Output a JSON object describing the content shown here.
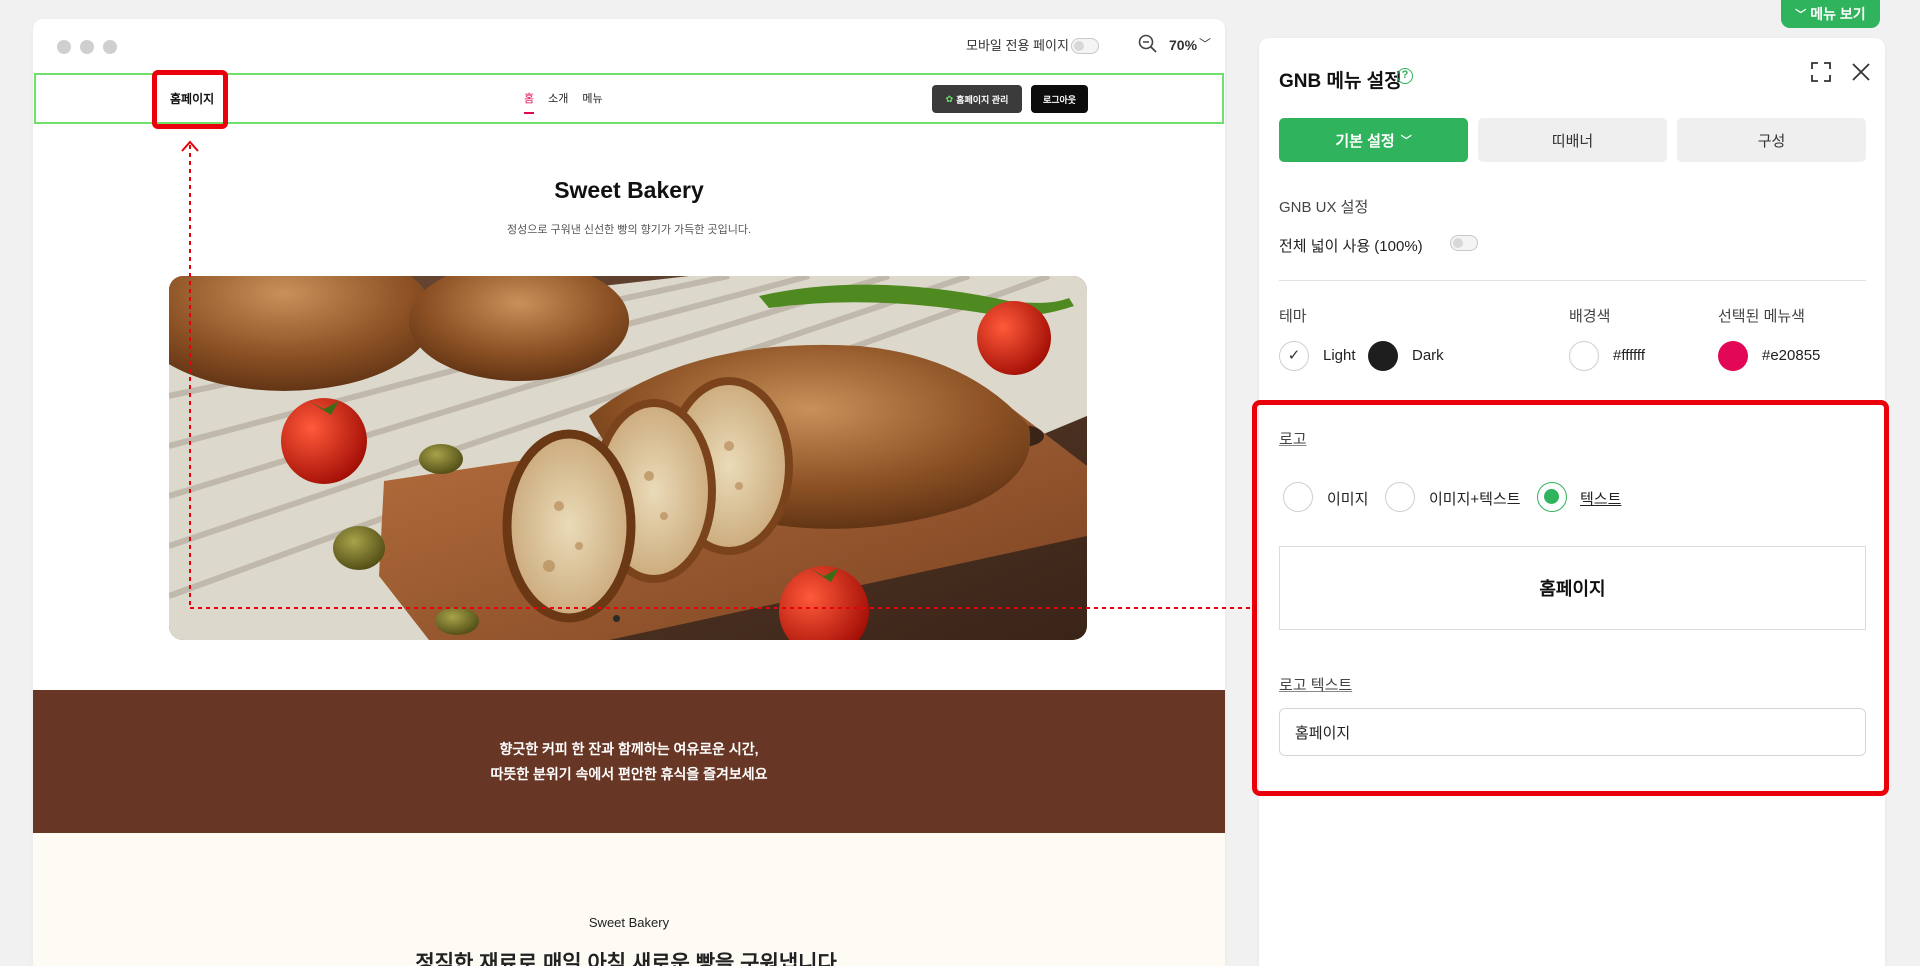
{
  "top_tab": {
    "label": "메뉴 보기"
  },
  "preview": {
    "mobile_toggle_label": "모바일 전용 페이지",
    "zoom": "70%",
    "nav": {
      "logo": "홈페이지",
      "menu": [
        "홈",
        "소개",
        "메뉴"
      ],
      "manage_button": "홈페이지 관리",
      "logout_button": "로그아웃"
    },
    "hero": {
      "title": "Sweet Bakery",
      "subtitle": "정성으로 구워낸 신선한 빵의 향기가 가득한 곳입니다."
    },
    "band": {
      "line1": "향긋한 커피 한 잔과 함께하는 여유로운 시간,",
      "line2": "따뜻한 분위기 속에서 편안한 휴식을 즐겨보세요"
    },
    "section": {
      "small": "Sweet Bakery",
      "heading": "정직한 재료로 매일 아침 새로운 빵을 구워냅니다."
    }
  },
  "panel": {
    "title": "GNB 메뉴 설정",
    "tabs": {
      "basic": "기본 설정",
      "banner": "띠배너",
      "compose": "구성"
    },
    "ux_label": "GNB UX 설정",
    "full_width_label": "전체 넓이 사용 (100%)",
    "theme": {
      "label": "테마",
      "light": "Light",
      "dark": "Dark"
    },
    "bg_color": {
      "label": "배경색",
      "value": "#ffffff"
    },
    "selected_color": {
      "label": "선택된 메뉴색",
      "value": "#e20855"
    },
    "logo": {
      "label": "로고",
      "options": [
        "이미지",
        "이미지+텍스트",
        "텍스트"
      ],
      "selected": "텍스트",
      "preview_text": "홈페이지",
      "text_label": "로고 텍스트",
      "text_value": "홈페이지"
    }
  },
  "colors": {
    "accent": "#2fb35c",
    "annotation": "#e9000b",
    "band": "#683625",
    "highlight": "#e20855"
  }
}
